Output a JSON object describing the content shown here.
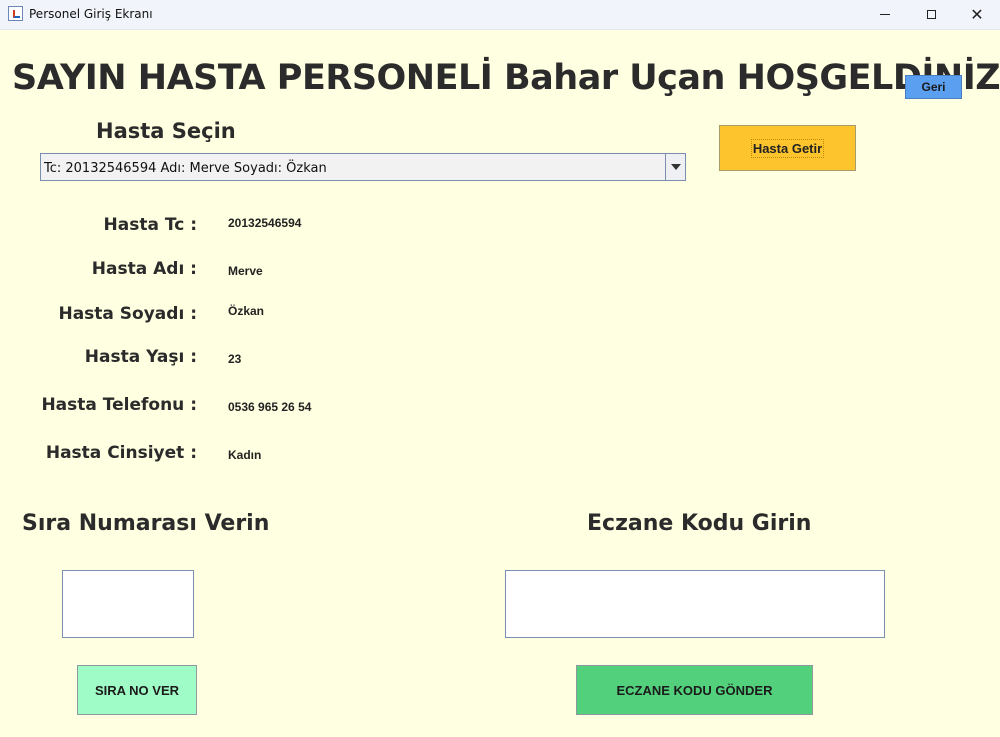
{
  "window": {
    "title": "Personel Giriş Ekranı",
    "minimize_glyph": "",
    "maximize_glyph": "",
    "close_glyph": "✕"
  },
  "header": {
    "welcome_text": "SAYIN HASTA PERSONELİ Bahar Uçan HOŞGELDİNİZ",
    "back_button": "Geri"
  },
  "patient_select": {
    "label": "Hasta Seçin",
    "selected_value": "Tc:  20132546594 Adı:  Merve Soyadı:  Özkan",
    "fetch_button": "Hasta Getir"
  },
  "patient_info": {
    "tc_label": "Hasta Tc :",
    "tc_value": "20132546594",
    "name_label": "Hasta Adı :",
    "name_value": "Merve",
    "surname_label": "Hasta Soyadı :",
    "surname_value": "Özkan",
    "age_label": "Hasta Yaşı :",
    "age_value": "23",
    "phone_label": "Hasta Telefonu :",
    "phone_value": "0536 965 26 54",
    "gender_label": "Hasta Cinsiyet :",
    "gender_value": "Kadın"
  },
  "queue": {
    "title": "Sıra Numarası Verin",
    "input_value": "",
    "button": "SIRA NO VER"
  },
  "pharmacy": {
    "title": "Eczane Kodu Girin",
    "input_value": "",
    "button": "ECZANE KODU GÖNDER"
  },
  "colors": {
    "background": "#ffffe1",
    "back_button": "#5a9ff0",
    "fetch_button": "#fec42e",
    "queue_button": "#9ffcc6",
    "pharmacy_button": "#52d07c"
  }
}
